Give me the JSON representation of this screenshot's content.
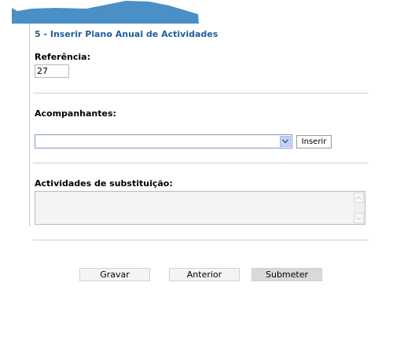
{
  "page": {
    "title": "5 - Inserir Plano Anual de Actividades"
  },
  "referencia": {
    "label": "Referência:",
    "value": "27"
  },
  "acompanhantes": {
    "label": "Acompanhantes:",
    "select_value": "",
    "insert_button": "Inserir"
  },
  "substituicao": {
    "label": "Actividades de substituição:",
    "value": ""
  },
  "actions": {
    "save": "Gravar",
    "previous": "Anterior",
    "submit": "Submeter"
  },
  "colors": {
    "title": "#1f5d9c",
    "banner": "#4a8fc6"
  }
}
